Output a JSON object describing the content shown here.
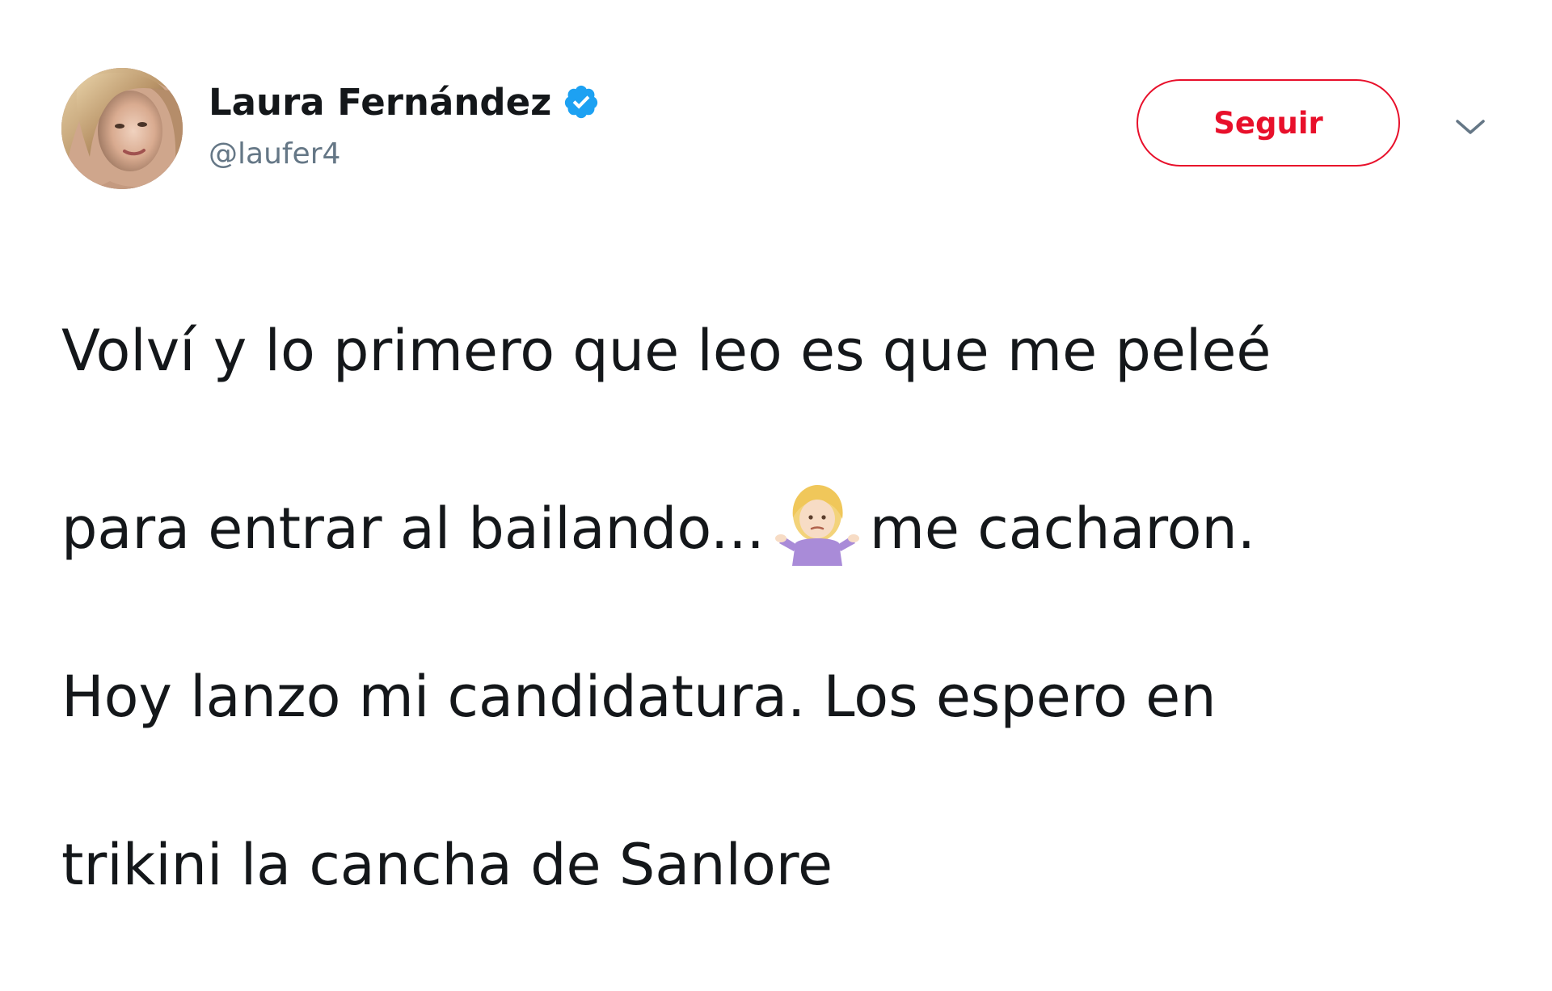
{
  "user": {
    "display_name": "Laura Fernández",
    "handle": "@laufer4",
    "verified": true
  },
  "actions": {
    "follow_label": "Seguir",
    "menu_icon": "chevron-down-icon"
  },
  "tweet": {
    "line1": "Volví y lo primero que leo es que me peleé",
    "line2_before_emoji": "para entrar al bailando...",
    "emoji": "person-shrugging-emoji",
    "line2_after_emoji": "me cacharon.",
    "line3": "Hoy lanzo mi candidatura. Los espero en",
    "line4": "trikini la cancha de Sanlore"
  },
  "colors": {
    "follow_accent": "#e8102b",
    "verified_badge": "#1da1f2",
    "handle_text": "#657786",
    "body_text": "#14171a"
  }
}
